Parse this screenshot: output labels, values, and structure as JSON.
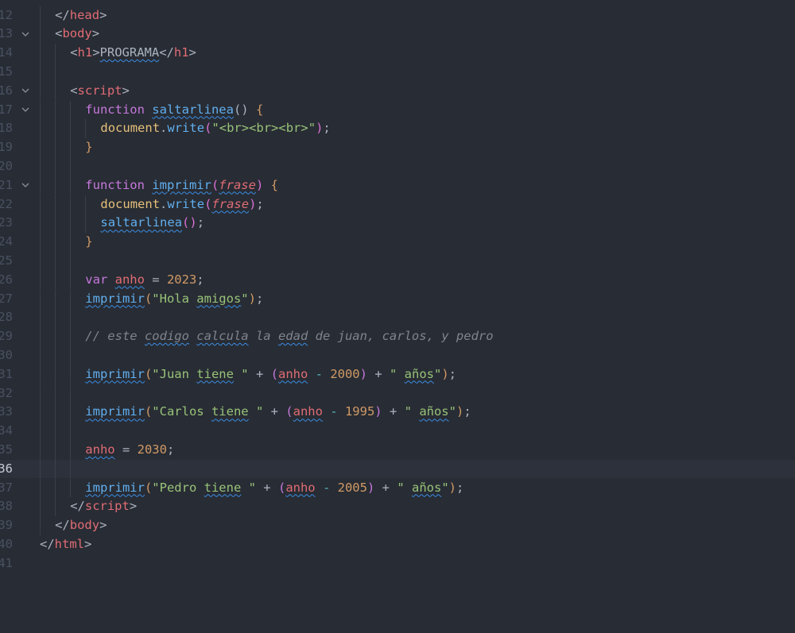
{
  "editor": {
    "language": "html",
    "current_line": 36,
    "colors": {
      "background": "#282c34",
      "tag": "#e06c75",
      "keyword": "#c678dd",
      "function": "#61afef",
      "string": "#98c379",
      "number": "#d19a66",
      "comment": "#7f848e",
      "object": "#e5c07b",
      "operator": "#56b6c2",
      "squiggle": "#3a8ee6"
    },
    "lines": [
      {
        "n": 12,
        "indent": 1,
        "fold": false,
        "tokens": [
          [
            "</",
            "t-punct"
          ],
          [
            "head",
            "t-tag"
          ],
          [
            ">",
            "t-punct"
          ]
        ]
      },
      {
        "n": 13,
        "indent": 1,
        "fold": true,
        "tokens": [
          [
            "<",
            "t-punct"
          ],
          [
            "body",
            "t-tag"
          ],
          [
            ">",
            "t-punct"
          ]
        ]
      },
      {
        "n": 14,
        "indent": 2,
        "fold": false,
        "tokens": [
          [
            "<",
            "t-punct"
          ],
          [
            "h1",
            "t-tag"
          ],
          [
            ">",
            "t-punct"
          ],
          [
            "PROGRAMA",
            "sq"
          ],
          [
            "</",
            "t-punct"
          ],
          [
            "h1",
            "t-tag"
          ],
          [
            ">",
            "t-punct"
          ]
        ]
      },
      {
        "n": 15,
        "indent": 0,
        "fold": false,
        "tokens": []
      },
      {
        "n": 16,
        "indent": 2,
        "fold": true,
        "tokens": [
          [
            "<",
            "t-punct"
          ],
          [
            "script",
            "t-tag"
          ],
          [
            ">",
            "t-punct"
          ]
        ]
      },
      {
        "n": 17,
        "indent": 3,
        "fold": true,
        "tokens": [
          [
            "function",
            "t-kw"
          ],
          [
            " ",
            ""
          ],
          [
            "saltarlinea",
            "t-fn sq"
          ],
          [
            "()",
            "t-punct"
          ],
          [
            " {",
            "t-num"
          ]
        ]
      },
      {
        "n": 18,
        "indent": 4,
        "fold": false,
        "tokens": [
          [
            "document",
            "t-obj"
          ],
          [
            ".",
            "t-punct"
          ],
          [
            "write",
            "t-fn"
          ],
          [
            "(",
            "t-br"
          ],
          [
            "\"<br><br><br>\"",
            "t-str"
          ],
          [
            ")",
            "t-br"
          ],
          [
            ";",
            "t-punct"
          ]
        ]
      },
      {
        "n": 19,
        "indent": 3,
        "fold": false,
        "tokens": [
          [
            "}",
            "t-num"
          ]
        ]
      },
      {
        "n": 20,
        "indent": 0,
        "fold": false,
        "tokens": []
      },
      {
        "n": 21,
        "indent": 3,
        "fold": true,
        "tokens": [
          [
            "function",
            "t-kw"
          ],
          [
            " ",
            ""
          ],
          [
            "imprimir",
            "t-fn sq"
          ],
          [
            "(",
            "t-br"
          ],
          [
            "frase",
            "t-param sq"
          ],
          [
            ")",
            "t-br"
          ],
          [
            " {",
            "t-num"
          ]
        ]
      },
      {
        "n": 22,
        "indent": 4,
        "fold": false,
        "tokens": [
          [
            "document",
            "t-obj"
          ],
          [
            ".",
            "t-punct"
          ],
          [
            "write",
            "t-fn"
          ],
          [
            "(",
            "t-br"
          ],
          [
            "frase",
            "t-param sq"
          ],
          [
            ")",
            "t-br"
          ],
          [
            ";",
            "t-punct"
          ]
        ]
      },
      {
        "n": 23,
        "indent": 4,
        "fold": false,
        "tokens": [
          [
            "saltarlinea",
            "t-fn sq"
          ],
          [
            "()",
            "t-br"
          ],
          [
            ";",
            "t-punct"
          ]
        ]
      },
      {
        "n": 24,
        "indent": 3,
        "fold": false,
        "tokens": [
          [
            "}",
            "t-num"
          ]
        ]
      },
      {
        "n": 25,
        "indent": 0,
        "fold": false,
        "tokens": []
      },
      {
        "n": 26,
        "indent": 3,
        "fold": false,
        "tokens": [
          [
            "var",
            "t-kw"
          ],
          [
            " ",
            ""
          ],
          [
            "anho",
            "t-var sq"
          ],
          [
            " = ",
            "t-punct"
          ],
          [
            "2023",
            "t-num"
          ],
          [
            ";",
            "t-punct"
          ]
        ]
      },
      {
        "n": 27,
        "indent": 3,
        "fold": false,
        "tokens": [
          [
            "imprimir",
            "t-fn sq"
          ],
          [
            "(",
            "t-num"
          ],
          [
            "\"Hola ",
            "t-str"
          ],
          [
            "amigos",
            "t-str sq"
          ],
          [
            "\"",
            "t-str"
          ],
          [
            ")",
            "t-num"
          ],
          [
            ";",
            "t-punct"
          ]
        ]
      },
      {
        "n": 28,
        "indent": 0,
        "fold": false,
        "tokens": []
      },
      {
        "n": 29,
        "indent": 3,
        "fold": false,
        "tokens": [
          [
            "// este ",
            "t-comment"
          ],
          [
            "codigo",
            "t-comment sq"
          ],
          [
            " ",
            "t-comment"
          ],
          [
            "calcula",
            "t-comment sq"
          ],
          [
            " la ",
            "t-comment"
          ],
          [
            "edad",
            "t-comment sq"
          ],
          [
            " de juan, carlos, y pedro",
            "t-comment"
          ]
        ]
      },
      {
        "n": 30,
        "indent": 0,
        "fold": false,
        "tokens": []
      },
      {
        "n": 31,
        "indent": 3,
        "fold": false,
        "tokens": [
          [
            "imprimir",
            "t-fn sq"
          ],
          [
            "(",
            "t-num"
          ],
          [
            "\"Juan ",
            "t-str"
          ],
          [
            "tiene",
            "t-str sq"
          ],
          [
            " \"",
            "t-str"
          ],
          [
            " + ",
            "t-punct"
          ],
          [
            "(",
            "t-kw"
          ],
          [
            "anho",
            "t-var sq"
          ],
          [
            " - ",
            "t-op"
          ],
          [
            "2000",
            "t-num"
          ],
          [
            ")",
            "t-kw"
          ],
          [
            " + ",
            "t-punct"
          ],
          [
            "\" ",
            "t-str"
          ],
          [
            "años",
            "t-str sq"
          ],
          [
            "\"",
            "t-str"
          ],
          [
            ")",
            "t-num"
          ],
          [
            ";",
            "t-punct"
          ]
        ]
      },
      {
        "n": 32,
        "indent": 0,
        "fold": false,
        "tokens": []
      },
      {
        "n": 33,
        "indent": 3,
        "fold": false,
        "tokens": [
          [
            "imprimir",
            "t-fn sq"
          ],
          [
            "(",
            "t-num"
          ],
          [
            "\"Carlos ",
            "t-str"
          ],
          [
            "tiene",
            "t-str sq"
          ],
          [
            " \"",
            "t-str"
          ],
          [
            " + ",
            "t-punct"
          ],
          [
            "(",
            "t-kw"
          ],
          [
            "anho",
            "t-var sq"
          ],
          [
            " - ",
            "t-op"
          ],
          [
            "1995",
            "t-num"
          ],
          [
            ")",
            "t-kw"
          ],
          [
            " + ",
            "t-punct"
          ],
          [
            "\" ",
            "t-str"
          ],
          [
            "años",
            "t-str sq"
          ],
          [
            "\"",
            "t-str"
          ],
          [
            ")",
            "t-num"
          ],
          [
            ";",
            "t-punct"
          ]
        ]
      },
      {
        "n": 34,
        "indent": 0,
        "fold": false,
        "tokens": []
      },
      {
        "n": 35,
        "indent": 3,
        "fold": false,
        "tokens": [
          [
            "anho",
            "t-var sq"
          ],
          [
            " = ",
            "t-punct"
          ],
          [
            "2030",
            "t-num"
          ],
          [
            ";",
            "t-punct"
          ]
        ]
      },
      {
        "n": 36,
        "indent": 0,
        "fold": false,
        "tokens": []
      },
      {
        "n": 37,
        "indent": 3,
        "fold": false,
        "tokens": [
          [
            "imprimir",
            "t-fn sq"
          ],
          [
            "(",
            "t-num"
          ],
          [
            "\"Pedro ",
            "t-str"
          ],
          [
            "tiene",
            "t-str sq"
          ],
          [
            " \"",
            "t-str"
          ],
          [
            " + ",
            "t-punct"
          ],
          [
            "(",
            "t-kw"
          ],
          [
            "anho",
            "t-var sq"
          ],
          [
            " - ",
            "t-op"
          ],
          [
            "2005",
            "t-num"
          ],
          [
            ")",
            "t-kw"
          ],
          [
            " + ",
            "t-punct"
          ],
          [
            "\" ",
            "t-str"
          ],
          [
            "años",
            "t-str sq"
          ],
          [
            "\"",
            "t-str"
          ],
          [
            ")",
            "t-num"
          ],
          [
            ";",
            "t-punct"
          ]
        ]
      },
      {
        "n": 38,
        "indent": 2,
        "fold": false,
        "tokens": [
          [
            "</",
            "t-punct"
          ],
          [
            "script",
            "t-tag"
          ],
          [
            ">",
            "t-punct"
          ]
        ]
      },
      {
        "n": 39,
        "indent": 1,
        "fold": false,
        "tokens": [
          [
            "</",
            "t-punct"
          ],
          [
            "body",
            "t-tag"
          ],
          [
            ">",
            "t-punct"
          ]
        ]
      },
      {
        "n": 40,
        "indent": 0,
        "fold": false,
        "tokens": [
          [
            "</",
            "t-punct"
          ],
          [
            "html",
            "t-tag"
          ],
          [
            ">",
            "t-punct"
          ]
        ]
      },
      {
        "n": 41,
        "indent": 0,
        "fold": false,
        "tokens": []
      }
    ]
  }
}
